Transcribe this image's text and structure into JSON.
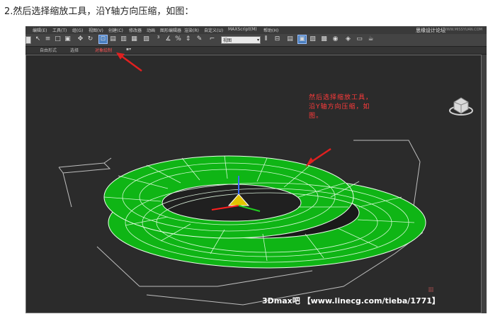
{
  "caption": "2.然后选择缩放工具，沿Y轴方向压缩，如图：",
  "menu": {
    "items": [
      "编辑(E)",
      "工具(T)",
      "组(G)",
      "视图(V)",
      "创建(C)",
      "修改器",
      "动画",
      "图形编辑器",
      "渲染(R)",
      "自定义(U)",
      "MAXScript(M)",
      "帮助(H)"
    ],
    "brand": "思缘设计论坛",
    "brand_url": "WWW.MISSYUAN.COM"
  },
  "toolbar": {
    "view_dropdown": "视图"
  },
  "ribbon": {
    "items": [
      "自由形式",
      "选择",
      "对象绘制"
    ]
  },
  "annotation": "然后选择缩放工具，沿Y轴方向压缩，如图。",
  "watermark": "3Dmax吧  【www.linecg.com/tieba/1771】",
  "colors": {
    "mesh": "#0fb515",
    "wire": "#e8ffe8",
    "annotation": "#ff3b3b",
    "highlight": "#4a7fc0"
  }
}
